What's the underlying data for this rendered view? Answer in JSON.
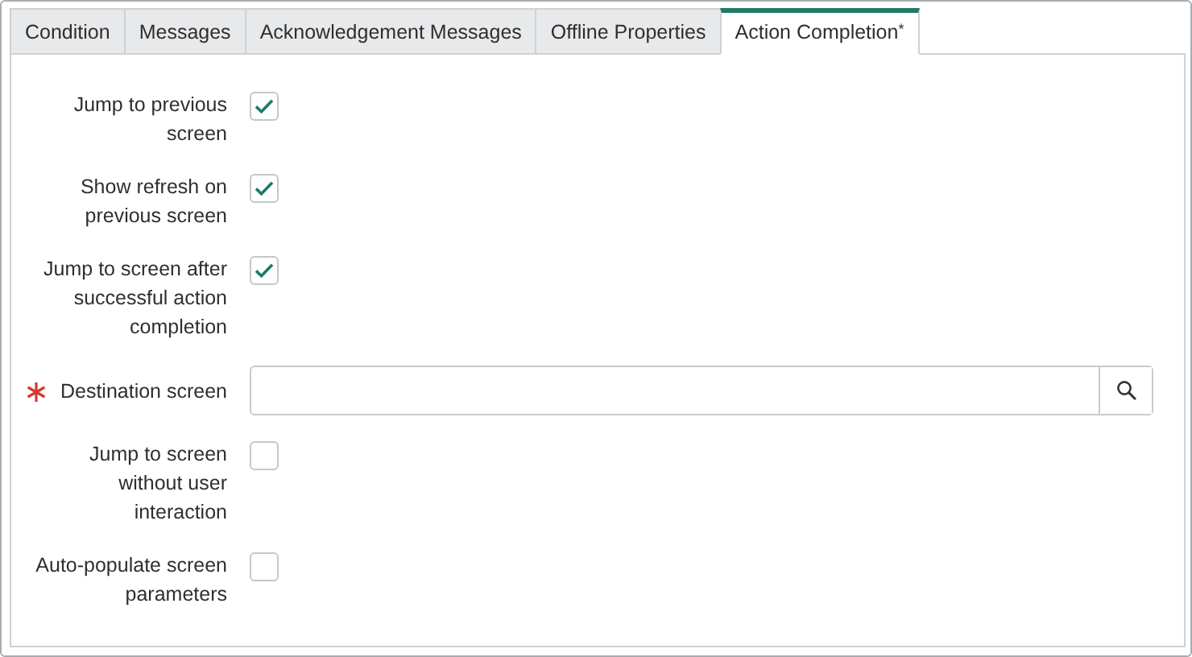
{
  "tabs": [
    {
      "label": "Condition",
      "selected": false
    },
    {
      "label": "Messages",
      "selected": false
    },
    {
      "label": "Acknowledgement Messages",
      "selected": false
    },
    {
      "label": "Offline Properties",
      "selected": false
    },
    {
      "label": "Action Completion$^{*}$",
      "selected": true
    }
  ],
  "fields": [
    {
      "kind": "checkbox",
      "label": "Jump to previous screen",
      "checked": true
    },
    {
      "kind": "checkbox",
      "label": "Show refresh on previous screen",
      "checked": true
    },
    {
      "kind": "checkbox",
      "label": "Jump to screen after successful action completion",
      "checked": true
    },
    {
      "kind": "lookup",
      "label": "Destination screen",
      "required": true
    },
    {
      "kind": "checkbox",
      "label": "Jump to screen without user interaction",
      "checked": false
    },
    {
      "kind": "checkbox",
      "label": "Auto-populate screen parameters",
      "checked": false
    }
  ]
}
